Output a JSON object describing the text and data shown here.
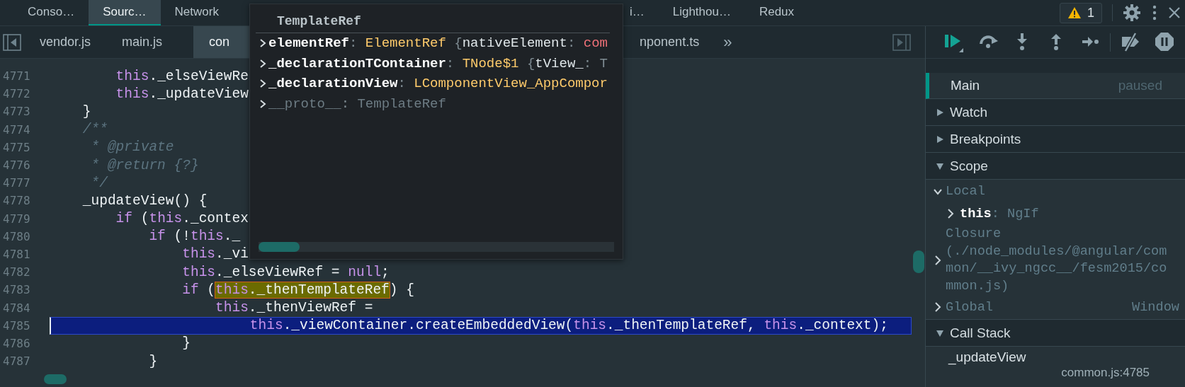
{
  "main_tabs": [
    {
      "label": "Conso…",
      "selected": false
    },
    {
      "label": "Sourc…",
      "selected": true
    },
    {
      "label": "Network",
      "selected": false
    },
    {
      "label": "i…",
      "selected": false
    },
    {
      "label": "Lighthou…",
      "selected": false
    },
    {
      "label": "Redux",
      "selected": false
    }
  ],
  "warnings": {
    "count": "1"
  },
  "file_tabs": [
    {
      "label": "vendor.js",
      "selected": false
    },
    {
      "label": "main.js",
      "selected": false
    },
    {
      "label": "con",
      "selected": true
    },
    {
      "label": "nponent.ts",
      "selected": false
    }
  ],
  "more_tabs": "»",
  "code": {
    "lines": [
      {
        "number": "4771",
        "kind": "normal",
        "segments": [
          {
            "text": "        this",
            "kind": "keyword"
          },
          {
            "text": "._elseViewRe",
            "kind": "plain"
          }
        ]
      },
      {
        "number": "4772",
        "kind": "normal",
        "segments": [
          {
            "text": "        this",
            "kind": "keyword"
          },
          {
            "text": "._updateView",
            "kind": "plain"
          }
        ]
      },
      {
        "number": "4773",
        "kind": "normal",
        "segments": [
          {
            "text": "    }",
            "kind": "plain"
          }
        ]
      },
      {
        "number": "4774",
        "kind": "normal",
        "segments": [
          {
            "text": "    /**",
            "kind": "comment"
          }
        ]
      },
      {
        "number": "4775",
        "kind": "normal",
        "segments": [
          {
            "text": "     * @private",
            "kind": "comment"
          }
        ]
      },
      {
        "number": "4776",
        "kind": "normal",
        "segments": [
          {
            "text": "     * @return {?}",
            "kind": "comment"
          }
        ]
      },
      {
        "number": "4777",
        "kind": "normal",
        "segments": [
          {
            "text": "     */",
            "kind": "comment"
          }
        ]
      },
      {
        "number": "4778",
        "kind": "normal",
        "segments": [
          {
            "text": "    _updateView() {",
            "kind": "plain"
          }
        ]
      },
      {
        "number": "4779",
        "kind": "normal",
        "segments": [
          {
            "text": "        if",
            "kind": "keyword"
          },
          {
            "text": " (",
            "kind": "plain"
          },
          {
            "text": "this",
            "kind": "keyword"
          },
          {
            "text": "._contex",
            "kind": "plain"
          }
        ]
      },
      {
        "number": "4780",
        "kind": "normal",
        "segments": [
          {
            "text": "            if",
            "kind": "keyword"
          },
          {
            "text": " (!",
            "kind": "plain"
          },
          {
            "text": "this",
            "kind": "keyword"
          },
          {
            "text": "._",
            "kind": "plain"
          }
        ]
      },
      {
        "number": "4781",
        "kind": "normal",
        "segments": [
          {
            "text": "                this",
            "kind": "keyword"
          },
          {
            "text": "._vi",
            "kind": "plain"
          }
        ]
      },
      {
        "number": "4782",
        "kind": "normal",
        "segments": [
          {
            "text": "                this",
            "kind": "keyword"
          },
          {
            "text": "._elseViewRef = ",
            "kind": "plain"
          },
          {
            "text": "null",
            "kind": "keyword"
          },
          {
            "text": ";",
            "kind": "plain"
          }
        ]
      },
      {
        "number": "4783",
        "kind": "normal",
        "segments": [
          {
            "text": "                if",
            "kind": "keyword"
          },
          {
            "text": " (",
            "kind": "plain"
          },
          {
            "text": "this",
            "kind": "keyword",
            "hover": true
          },
          {
            "text": "._thenTemplateRef",
            "kind": "plain",
            "hover": true
          },
          {
            "text": ") {",
            "kind": "plain"
          }
        ]
      },
      {
        "number": "4784",
        "kind": "normal",
        "segments": [
          {
            "text": "                    this",
            "kind": "keyword"
          },
          {
            "text": "._thenViewRef =",
            "kind": "plain"
          }
        ]
      },
      {
        "number": "4785",
        "kind": "execution",
        "segments": [
          {
            "text": "                        this",
            "kind": "keyword"
          },
          {
            "text": "._viewContainer.createEmbeddedView(",
            "kind": "plain"
          },
          {
            "text": "this",
            "kind": "keyword"
          },
          {
            "text": "._thenTemplateRef, ",
            "kind": "plain"
          },
          {
            "text": "this",
            "kind": "keyword"
          },
          {
            "text": "._context);",
            "kind": "plain"
          }
        ]
      },
      {
        "number": "4786",
        "kind": "normal",
        "segments": [
          {
            "text": "                }",
            "kind": "plain"
          }
        ]
      },
      {
        "number": "4787",
        "kind": "normal",
        "segments": [
          {
            "text": "            }",
            "kind": "plain"
          }
        ]
      }
    ]
  },
  "popover": {
    "title": "TemplateRef",
    "rows": [
      {
        "expanded": false,
        "segments": [
          {
            "text": "elementRef",
            "kind": "name"
          },
          {
            "text": ": ",
            "kind": "punct"
          },
          {
            "text": "ElementRef",
            "kind": "type"
          },
          {
            "text": " {",
            "kind": "punct"
          },
          {
            "text": "nativeElement",
            "kind": "prop"
          },
          {
            "text": ": ",
            "kind": "punct"
          },
          {
            "text": "com",
            "kind": "string"
          }
        ]
      },
      {
        "expanded": false,
        "segments": [
          {
            "text": "_declarationTContainer",
            "kind": "name"
          },
          {
            "text": ": ",
            "kind": "punct"
          },
          {
            "text": "TNode$1",
            "kind": "type"
          },
          {
            "text": " {",
            "kind": "punct"
          },
          {
            "text": "tView_",
            "kind": "prop"
          },
          {
            "text": ": T",
            "kind": "punct"
          }
        ]
      },
      {
        "expanded": false,
        "segments": [
          {
            "text": "_declarationView",
            "kind": "name"
          },
          {
            "text": ": ",
            "kind": "punct"
          },
          {
            "text": "LComponentView_AppCompor",
            "kind": "type"
          }
        ]
      },
      {
        "expanded": false,
        "segments": [
          {
            "text": "__proto__",
            "kind": "dim"
          },
          {
            "text": ": ",
            "kind": "punct"
          },
          {
            "text": "TemplateRef",
            "kind": "dim"
          }
        ]
      }
    ]
  },
  "threads": [
    {
      "name": "Main",
      "status": "paused",
      "selected": true
    }
  ],
  "sections": [
    {
      "title": "Watch",
      "expanded": false
    },
    {
      "title": "Breakpoints",
      "expanded": false
    },
    {
      "title": "Scope",
      "expanded": true,
      "scopes": [
        {
          "name": "Local",
          "expanded": true,
          "variables": [
            {
              "name": "this",
              "separator": ":",
              "value": "NgIf",
              "expanded": false
            }
          ]
        },
        {
          "name": "Closure",
          "detail": "(./node_modules/@angular/common/__ivy_ngcc__/fesm2015/common.js)",
          "expanded": false
        },
        {
          "name": "Global",
          "value": "Window",
          "expanded": false
        }
      ]
    },
    {
      "title": "Call Stack",
      "expanded": true,
      "frames": [
        {
          "name": "_updateView",
          "location": "common.js:4785",
          "selected": false
        }
      ]
    }
  ]
}
